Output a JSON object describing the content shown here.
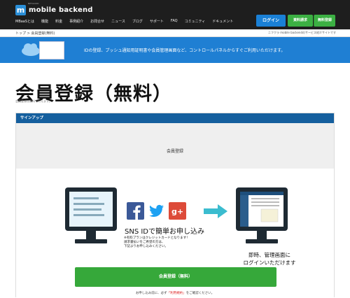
{
  "header": {
    "logo_mark": "m",
    "logo_text": "mobile backend",
    "logo_sub": "NIFCLOUD",
    "nav": [
      "MBaaSとは",
      "機能",
      "料金",
      "事例紹介",
      "お問合せ",
      "ニュース",
      "ブログ",
      "サポート",
      "FAQ",
      "コミュニティ",
      "ドキュメント"
    ],
    "login_label": "ログイン",
    "trial_label": "資料請求",
    "free_label": "無料登録"
  },
  "breadcrumb": {
    "text": "トップ > 会員登録(無料)",
    "right": "ニフクラ mobile backendのサービス紹介サイトです"
  },
  "banner": {
    "text": "IDの登録、プッシュ通知用証明書や会員管理画面など、コントロールパネルからすぐご利用いただけます。"
  },
  "page": {
    "title": "会員登録（無料）",
    "subtitle": "会員登録は無料で行えます。"
  },
  "panel": {
    "header": "サインアップ",
    "title": "会員登録",
    "sns_title": "SNS IDで簡単お申し込み",
    "note_lines": [
      "※有料プランはクレジットカードとなります！",
      "請求書払いをご希望の方は、",
      "下記よりお申し込みください。"
    ],
    "after_lines": [
      "即時、管理画面に",
      "ログインいただけます"
    ],
    "cta_label": "会員登録（無料）",
    "terms_before": "お申し込み前に、必ず",
    "terms_link": "「利用規約」",
    "terms_after": "をご確認ください。"
  },
  "colors": {
    "nav_bg": "#1e1e1e",
    "brand_blue": "#1a80d6",
    "green": "#36a83a",
    "panel_header": "#155f9e",
    "facebook": "#3b5998",
    "twitter": "#1da1f2",
    "google": "#dd4b39",
    "arrow": "#3bbccf"
  },
  "icons": [
    "facebook-icon",
    "twitter-icon",
    "google-plus-icon",
    "arrow-right-icon",
    "monitor-icon",
    "cloud-icon"
  ]
}
